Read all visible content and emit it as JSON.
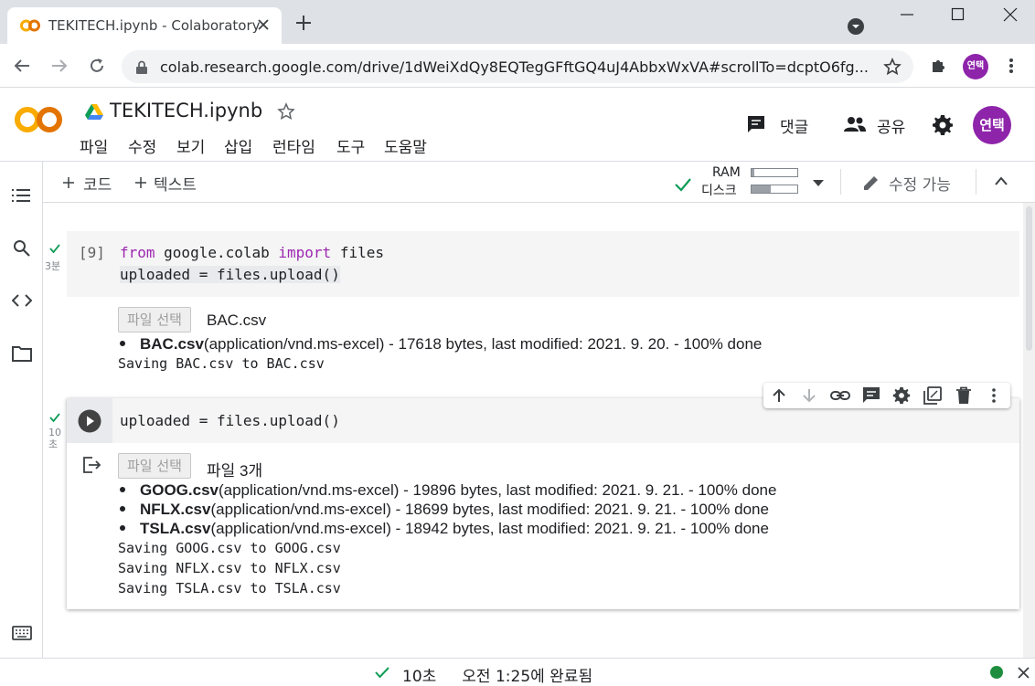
{
  "browser": {
    "tab_title": "TEKITECH.ipynb - Colaboratory",
    "url": "colab.research.google.com/drive/1dWeiXdQy8EQTegGFftGQ4uJ4AbbxWxVA#scrollTo=dcptO6fg...",
    "profile_initials": "연택"
  },
  "header": {
    "logo_text": "CO",
    "notebook_title": "TEKITECH.ipynb",
    "menu": [
      "파일",
      "수정",
      "보기",
      "삽입",
      "런타임",
      "도구",
      "도움말"
    ],
    "comment_label": "댓글",
    "share_label": "공유",
    "avatar_initials": "연택"
  },
  "toolbar": {
    "add_code": "코드",
    "add_text": "텍스트",
    "ram_label": "RAM",
    "disk_label": "디스크",
    "ram_fraction": 0.05,
    "disk_fraction": 0.42,
    "edit_mode": "수정 가능"
  },
  "cells": [
    {
      "exec_count": "[9]",
      "run_time": "3분",
      "code_line1": {
        "kw1": "from",
        "mid": " google.colab ",
        "kw2": "import",
        "end": " files"
      },
      "code_line2": "uploaded = files.upload()",
      "choose_button": "파일 선택",
      "chosen": "BAC.csv",
      "files": [
        {
          "name": "BAC.csv",
          "detail": "(application/vnd.ms-excel) - 17618 bytes, last modified: 2021. 9. 20. - 100% done"
        }
      ],
      "saving": [
        "Saving BAC.csv to BAC.csv"
      ]
    },
    {
      "run_time": "10\n초",
      "code": "uploaded = files.upload()",
      "choose_button": "파일 선택",
      "chosen": "파일 3개",
      "files": [
        {
          "name": "GOOG.csv",
          "detail": "(application/vnd.ms-excel) - 19896 bytes, last modified: 2021. 9. 21. - 100% done"
        },
        {
          "name": "NFLX.csv",
          "detail": "(application/vnd.ms-excel) - 18699 bytes, last modified: 2021. 9. 21. - 100% done"
        },
        {
          "name": "TSLA.csv",
          "detail": "(application/vnd.ms-excel) - 18942 bytes, last modified: 2021. 9. 21. - 100% done"
        }
      ],
      "saving": [
        "Saving GOOG.csv to GOOG.csv",
        "Saving NFLX.csv to NFLX.csv",
        "Saving TSLA.csv to TSLA.csv"
      ]
    }
  ],
  "status": {
    "duration": "10초",
    "completed": "오전 1:25에 완료됨"
  },
  "colors": {
    "accent_orange": "#f9ab00",
    "accent_check": "#0f9d58",
    "avatar": "#8e24aa",
    "keyword": "#9c27b0"
  },
  "icons": [
    "colab-logo-icon",
    "close-icon",
    "plus-icon",
    "back-icon",
    "forward-icon",
    "reload-icon",
    "lock-icon",
    "star-icon",
    "extension-icon",
    "menu-dots-icon",
    "drive-icon",
    "comment-icon",
    "share-icon",
    "gear-icon",
    "toc-icon",
    "search-icon",
    "code-icon",
    "folder-icon",
    "terminal-icon",
    "check-icon",
    "chevron-down-icon",
    "pencil-icon",
    "chevron-up-icon",
    "run-icon",
    "output-icon",
    "arrow-up-icon",
    "arrow-down-icon",
    "link-icon",
    "mirror-icon",
    "trash-icon"
  ]
}
